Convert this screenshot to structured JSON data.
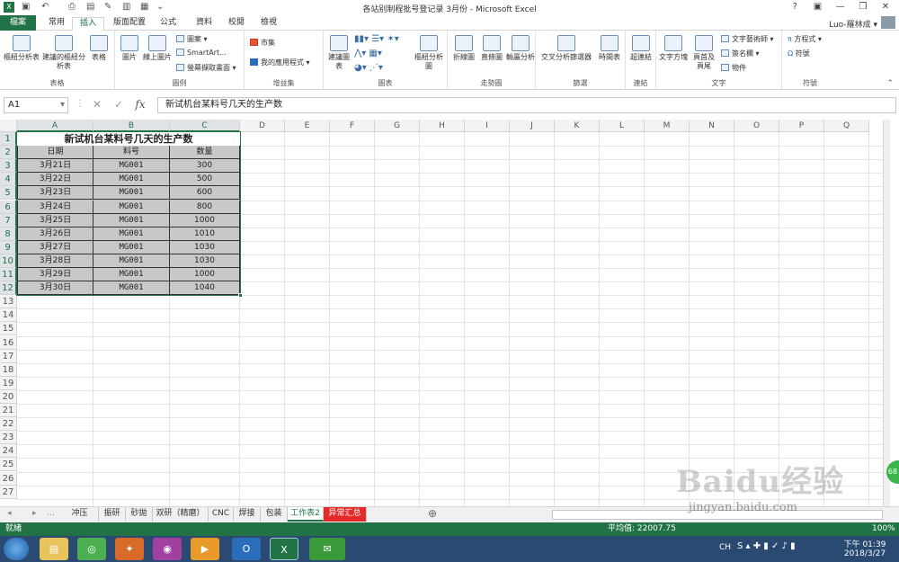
{
  "window": {
    "title": "各站别制程批号登记录 3月份 - Microsoft Excel",
    "help": "?",
    "minimize": "—",
    "restore": "❐",
    "close": "✕"
  },
  "tabs": [
    "檔案",
    "常用",
    "插入",
    "版面配置",
    "公式",
    "資料",
    "校閱",
    "檢視"
  ],
  "active_tab": "插入",
  "user": "Luo-羅林成",
  "ribbon": {
    "groups": [
      {
        "label": "表格",
        "buttons": [
          "樞紐分析表",
          "建議的樞紐分析表",
          "表格"
        ]
      },
      {
        "label": "圖例",
        "buttons": [
          "圖片",
          "線上圖片"
        ],
        "small": [
          "圖案",
          "SmartArt...",
          "螢幕擷取畫面"
        ]
      },
      {
        "label": "增益集",
        "small": [
          "市集",
          "我的應用程式"
        ]
      },
      {
        "label": "圖表",
        "buttons": [
          "建議圖表",
          "樞紐分析圖"
        ]
      },
      {
        "label": "走勢圖",
        "buttons": [
          "折線圖",
          "直條圖",
          "輸贏分析"
        ]
      },
      {
        "label": "篩選",
        "buttons": [
          "交叉分析篩選器",
          "時間表"
        ]
      },
      {
        "label": "連結",
        "buttons": [
          "超連結"
        ]
      },
      {
        "label": "文字",
        "buttons": [
          "文字方塊",
          "頁首及頁尾"
        ],
        "small": [
          "文字藝術師",
          "簽名欄",
          "物件"
        ]
      },
      {
        "label": "符號",
        "small": [
          "方程式",
          "符號"
        ]
      }
    ]
  },
  "formula_bar": {
    "name_box": "A1",
    "fx": "fx",
    "cancel": "✕",
    "enter": "✓",
    "content": "新试机台某料号几天的生产数"
  },
  "columns": [
    "A",
    "B",
    "C",
    "D",
    "E",
    "F",
    "G",
    "H",
    "I",
    "J",
    "K",
    "L",
    "M",
    "N",
    "O",
    "P",
    "Q"
  ],
  "rows": [
    "1",
    "2",
    "3",
    "4",
    "5",
    "6",
    "7",
    "8",
    "9",
    "10",
    "11",
    "12",
    "13",
    "14",
    "15",
    "16",
    "17",
    "18",
    "19",
    "20",
    "21",
    "22",
    "23",
    "24",
    "25",
    "26",
    "27"
  ],
  "table": {
    "title": "新试机台某料号几天的生产数",
    "headers": [
      "日期",
      "料号",
      "数量"
    ],
    "rows": [
      [
        "3月21日",
        "MG001",
        "300"
      ],
      [
        "3月22日",
        "MG001",
        "500"
      ],
      [
        "3月23日",
        "MG001",
        "600"
      ],
      [
        "3月24日",
        "MG001",
        "800"
      ],
      [
        "3月25日",
        "MG001",
        "1000"
      ],
      [
        "3月26日",
        "MG001",
        "1010"
      ],
      [
        "3月27日",
        "MG001",
        "1030"
      ],
      [
        "3月28日",
        "MG001",
        "1030"
      ],
      [
        "3月29日",
        "MG001",
        "1000"
      ],
      [
        "3月30日",
        "MG001",
        "1040"
      ]
    ]
  },
  "sheets": [
    "冲压",
    "振研",
    "砂拋",
    "双研（精磨）",
    "CNC",
    "焊接",
    "包装",
    "工作表2",
    "异常汇总"
  ],
  "active_sheet": "工作表2",
  "red_sheet": "异常汇总",
  "add_sheet": "⊕",
  "status": {
    "ready": "就緒",
    "average": "平均值: 22007.75",
    "zoom": "100%"
  },
  "taskbar": {
    "lang": "CH",
    "time": "下午 01:39",
    "date": "2018/3/27"
  },
  "watermark": {
    "brand": "Baidu经验",
    "url": "jingyan.baidu.com"
  },
  "side_badge": "68",
  "colors": {
    "excel_green": "#217346",
    "red_tab": "#e52a2a",
    "table_fill": "#c8c8c8"
  }
}
